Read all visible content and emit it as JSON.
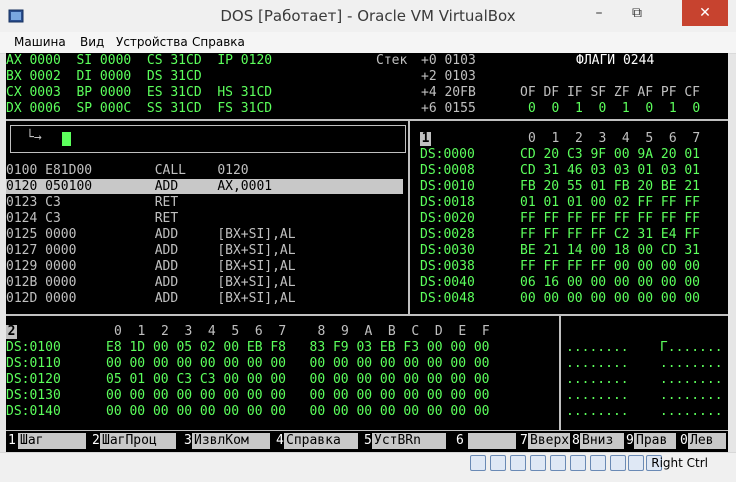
{
  "window": {
    "title": "DOS [Работает] - Oracle VM VirtualBox",
    "minimize": "–",
    "restore": "⧉",
    "close": "✕"
  },
  "menu": [
    "Машина",
    "Вид",
    "Устройства",
    "Справка"
  ],
  "registers": [
    "AX 0000  SI 0000  CS 31CD  IP 0120",
    "BX 0002  DI 0000  DS 31CD",
    "CX 0003  BP 0000  ES 31CD  HS 31CD",
    "DX 0006  SP 000C  SS 31CD  FS 31CD"
  ],
  "stack": {
    "label": "Стек",
    "rows": [
      "+0 0103",
      "+2 0103",
      "+4 20FB",
      "+6 0155"
    ]
  },
  "flags": {
    "label": "ФЛАГИ 0244",
    "names": "OF DF IF SF ZF AF PF CF",
    "values": "0  0  1  0  1  0  1  0"
  },
  "command": {
    "prompt": "└→"
  },
  "disasm": [
    "0100 E81D00        CALL    0120",
    "0120 050100        ADD     AX,0001",
    "0123 C3            RET",
    "0124 C3            RET",
    "0125 0000          ADD     [BX+SI],AL",
    "0127 0000          ADD     [BX+SI],AL",
    "0129 0000          ADD     [BX+SI],AL",
    "012B 0000          ADD     [BX+SI],AL",
    "012D 0000          ADD     [BX+SI],AL"
  ],
  "dump1": {
    "num": "1",
    "header": "0  1  2  3  4  5  6  7",
    "addrs": [
      "DS:0000",
      "DS:0008",
      "DS:0010",
      "DS:0018",
      "DS:0020",
      "DS:0028",
      "DS:0030",
      "DS:0038",
      "DS:0040",
      "DS:0048"
    ],
    "bytes": [
      "CD 20 C3 9F 00 9A 20 01",
      "CD 31 46 03 03 01 03 01",
      "FB 20 55 01 FB 20 BE 21",
      "01 01 01 00 02 FF FF FF",
      "FF FF FF FF FF FF FF FF",
      "FF FF FF FF C2 31 E4 FF",
      "BE 21 14 00 18 00 CD 31",
      "FF FF FF FF 00 00 00 00",
      "06 16 00 00 00 00 00 00",
      "00 00 00 00 00 00 00 00"
    ]
  },
  "dump2": {
    "num": "2",
    "header": "0  1  2  3  4  5  6  7    8  9  A  B  C  D  E  F",
    "addrs": [
      "DS:0100",
      "DS:0110",
      "DS:0120",
      "DS:0130",
      "DS:0140"
    ],
    "bytes": [
      "E8 1D 00 05 02 00 EB F8   83 F9 03 EB F3 00 00 00",
      "00 00 00 00 00 00 00 00   00 00 00 00 00 00 00 00",
      "05 01 00 C3 C3 00 00 00   00 00 00 00 00 00 00 00",
      "00 00 00 00 00 00 00 00   00 00 00 00 00 00 00 00",
      "00 00 00 00 00 00 00 00   00 00 00 00 00 00 00 00"
    ],
    "ascii": [
      "........    Г.......",
      "........    ........",
      "........    ........",
      "........    ........",
      "........    ........"
    ]
  },
  "fkeys": [
    {
      "num": "1",
      "label": " Шаг"
    },
    {
      "num": "2",
      "label": "ШагПроц"
    },
    {
      "num": "3",
      "label": "ИзвлКом"
    },
    {
      "num": "4",
      "label": "Справка"
    },
    {
      "num": "5",
      "label": "УстBRn"
    },
    {
      "num": "6",
      "label": ""
    },
    {
      "num": "7",
      "label": "Вверх"
    },
    {
      "num": "8",
      "label": "Вниз"
    },
    {
      "num": "9",
      "label": "Прав"
    },
    {
      "num": "0",
      "label": "Лев"
    }
  ],
  "status": {
    "host_key": "Right Ctrl"
  }
}
